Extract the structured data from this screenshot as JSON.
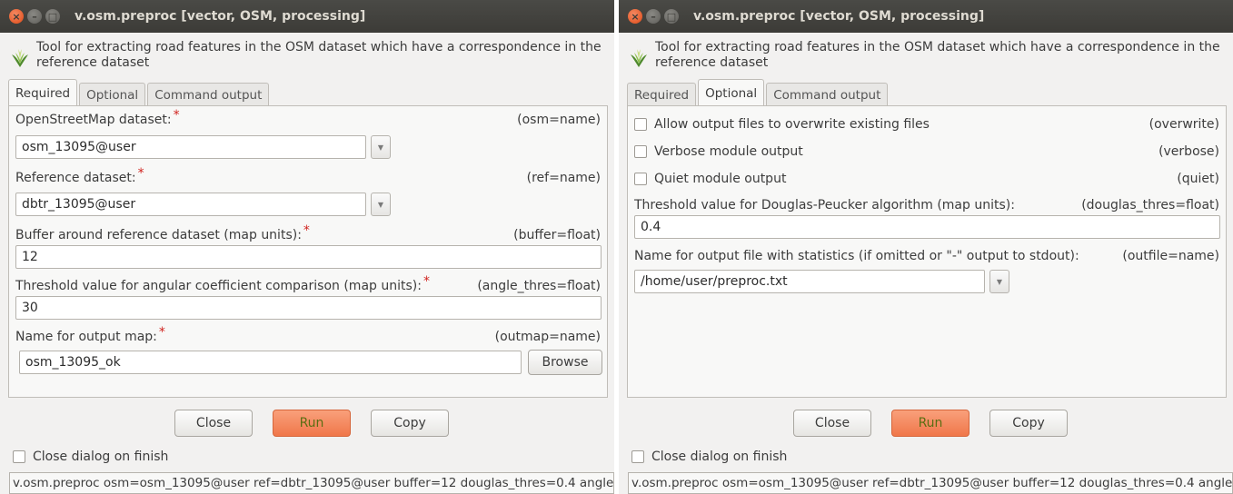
{
  "window_title": "v.osm.preproc [vector, OSM, processing]",
  "description": "Tool for extracting road features in the OSM dataset which have a correspondence in the reference dataset",
  "description_line1": "Tool for extracting road features in the OSM dataset which have a correspondence in the",
  "description_line2": "reference dataset",
  "tabs": [
    "Required",
    "Optional",
    "Command output"
  ],
  "required": {
    "osm": {
      "label": "OpenStreetMap dataset:",
      "param": "(osm=name)",
      "value": "osm_13095@user"
    },
    "ref": {
      "label": "Reference dataset:",
      "param": "(ref=name)",
      "value": "dbtr_13095@user"
    },
    "buffer": {
      "label": "Buffer around reference dataset (map units):",
      "param": "(buffer=float)",
      "value": "12"
    },
    "angle": {
      "label": "Threshold value for angular coefficient comparison (map units):",
      "param": "(angle_thres=float)",
      "value": "30"
    },
    "outmap": {
      "label": "Name for output map:",
      "param": "(outmap=name)",
      "value": "osm_13095_ok",
      "browse_label": "Browse"
    }
  },
  "optional": {
    "overwrite": {
      "label": "Allow output files to overwrite existing files",
      "param": "(overwrite)"
    },
    "verbose": {
      "label": "Verbose module output",
      "param": "(verbose)"
    },
    "quiet": {
      "label": "Quiet module output",
      "param": "(quiet)"
    },
    "douglas": {
      "label": "Threshold value for Douglas-Peucker algorithm (map units):",
      "param": "(douglas_thres=float)",
      "value": "0.4"
    },
    "outfile": {
      "label": "Name for output file with statistics (if omitted or \"-\" output to stdout):",
      "param": "(outfile=name)",
      "value": "/home/user/preproc.txt"
    }
  },
  "buttons": {
    "close": "Close",
    "run": "Run",
    "copy": "Copy"
  },
  "close_on_finish": "Close dialog on finish",
  "command": "v.osm.preproc osm=osm_13095@user ref=dbtr_13095@user buffer=12 douglas_thres=0.4 angle",
  "required_marker": "*",
  "colors": {
    "run_button": "#f0774a",
    "titlebar": "#3c3b37",
    "required_star": "#d0231f"
  },
  "titlebar_icons": [
    "close-icon",
    "minimize-icon",
    "maximize-icon"
  ],
  "dropdown_icon": "chevron-down-icon"
}
